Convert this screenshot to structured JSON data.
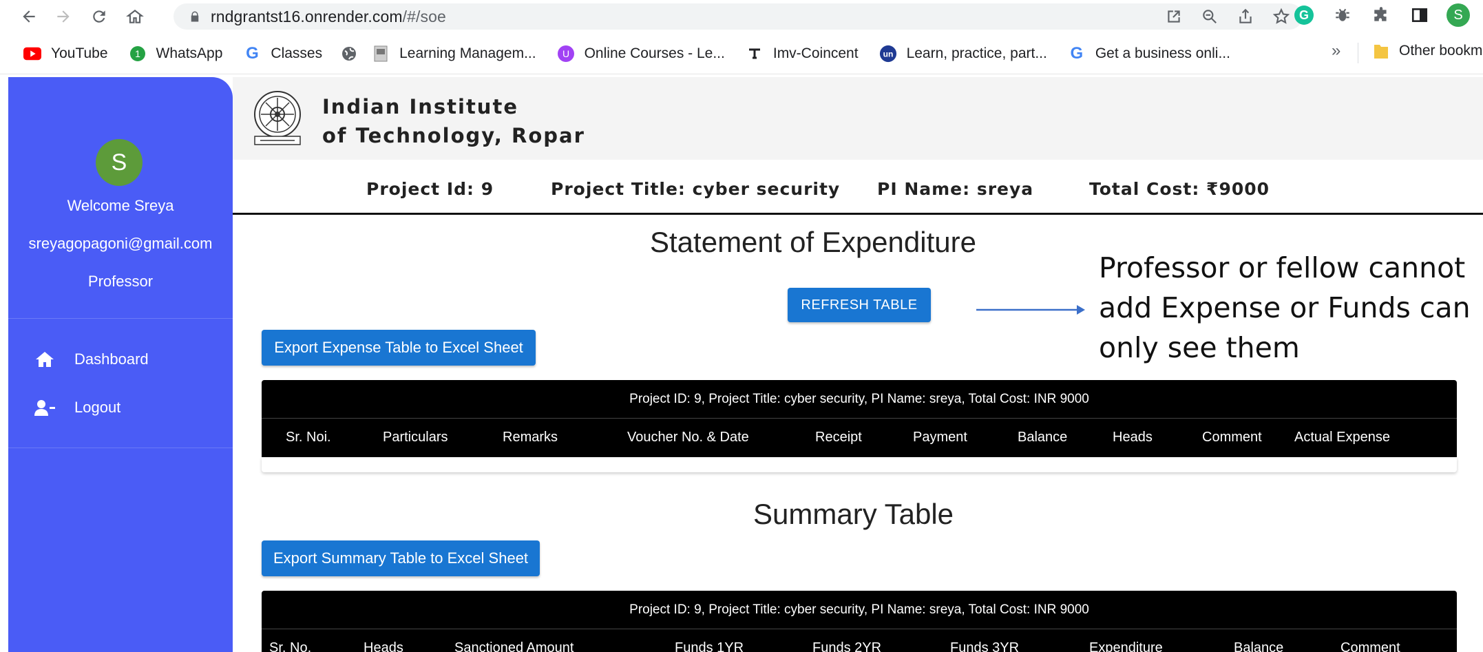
{
  "browser": {
    "url_host": "rndgrantst16.onrender.com",
    "url_path": "/#/soe",
    "profile_initial": "S",
    "bookmarks": [
      {
        "label": "YouTube"
      },
      {
        "label": "WhatsApp"
      },
      {
        "label": "Classes"
      },
      {
        "label": ""
      },
      {
        "label": "Learning Managem..."
      },
      {
        "label": "Online Courses - Le..."
      },
      {
        "label": "Imv-Coincent"
      },
      {
        "label": "Learn, practice, part..."
      },
      {
        "label": "Get a business onli..."
      }
    ],
    "more_label": "»",
    "other_bookmarks": "Other bookm"
  },
  "sidebar": {
    "avatar_initial": "S",
    "welcome": "Welcome Sreya",
    "email": "sreyagopagoni@gmail.com",
    "role": "Professor",
    "items": [
      {
        "label": "Dashboard"
      },
      {
        "label": "Logout"
      }
    ]
  },
  "header": {
    "institute_line1": "Indian Institute",
    "institute_line2": "of Technology, Ropar"
  },
  "project": {
    "id": "Project Id: 9",
    "title": "Project Title: cyber security",
    "pi": "PI Name: sreya",
    "cost": "Total Cost: ₹9000"
  },
  "soe": {
    "title": "Statement of Expenditure",
    "refresh_label": "REFRESH TABLE",
    "export_label": "Export Expense Table to Excel Sheet",
    "caption": "Project ID: 9, Project Title: cyber security, PI Name: sreya, Total Cost: INR 9000",
    "columns": [
      "Sr. Noi.",
      "Particulars",
      "Remarks",
      "Voucher No. & Date",
      "Receipt",
      "Payment",
      "Balance",
      "Heads",
      "Comment",
      "Actual Expense"
    ]
  },
  "annotation": {
    "line1": "Professor or fellow cannot",
    "line2": "add Expense or Funds can",
    "line3": "only see them"
  },
  "summary": {
    "title": "Summary Table",
    "export_label": "Export Summary Table to Excel Sheet",
    "caption": "Project ID: 9, Project Title: cyber security, PI Name: sreya, Total Cost: INR 9000",
    "columns": [
      "Sr. No.",
      "Heads",
      "Sanctioned Amount",
      "Funds 1YR",
      "Funds 2YR",
      "Funds 3YR",
      "Expenditure",
      "Balance",
      "Comment"
    ]
  },
  "colors": {
    "sidebar": "#4a5cf6",
    "button": "#1976d2",
    "avatar": "#5d9b3a"
  }
}
